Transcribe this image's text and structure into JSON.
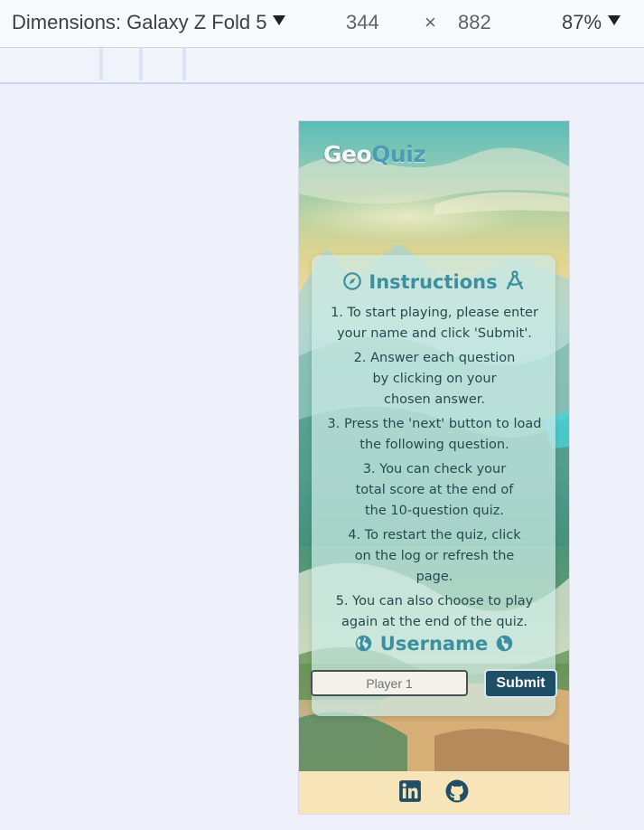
{
  "devtools": {
    "dimensions_label": "Dimensions: Galaxy Z Fold 5",
    "width": "344",
    "times": "×",
    "height": "882",
    "zoom": "87%"
  },
  "page": {
    "logo": {
      "geo": "Geo",
      "quiz": "Quiz"
    },
    "instructions_title": "Instructions",
    "instructions": [
      "1. To start playing, please enter your name and click 'Submit'.",
      "2. Answer each question by clicking on your chosen answer.",
      "3. Press the 'next' button to load the following question.",
      "3. You can check your total score at the end of the 10-question quiz.",
      "4. To restart the quiz, click on the log or refresh the page.",
      "5. You can also choose to play again at the end of the quiz."
    ],
    "username_title": "Username",
    "username_placeholder": "Player 1",
    "submit_label": "Submit"
  },
  "colors": {
    "accent": "#3d8fa0",
    "submit_bg": "#1e4f66",
    "footer_bg": "#f7e4b9",
    "icon": "#1e4f66"
  },
  "icons": [
    "caret-down-icon",
    "compass-icon",
    "drafting-compass-icon",
    "globe-icon",
    "linkedin-icon",
    "github-icon"
  ]
}
